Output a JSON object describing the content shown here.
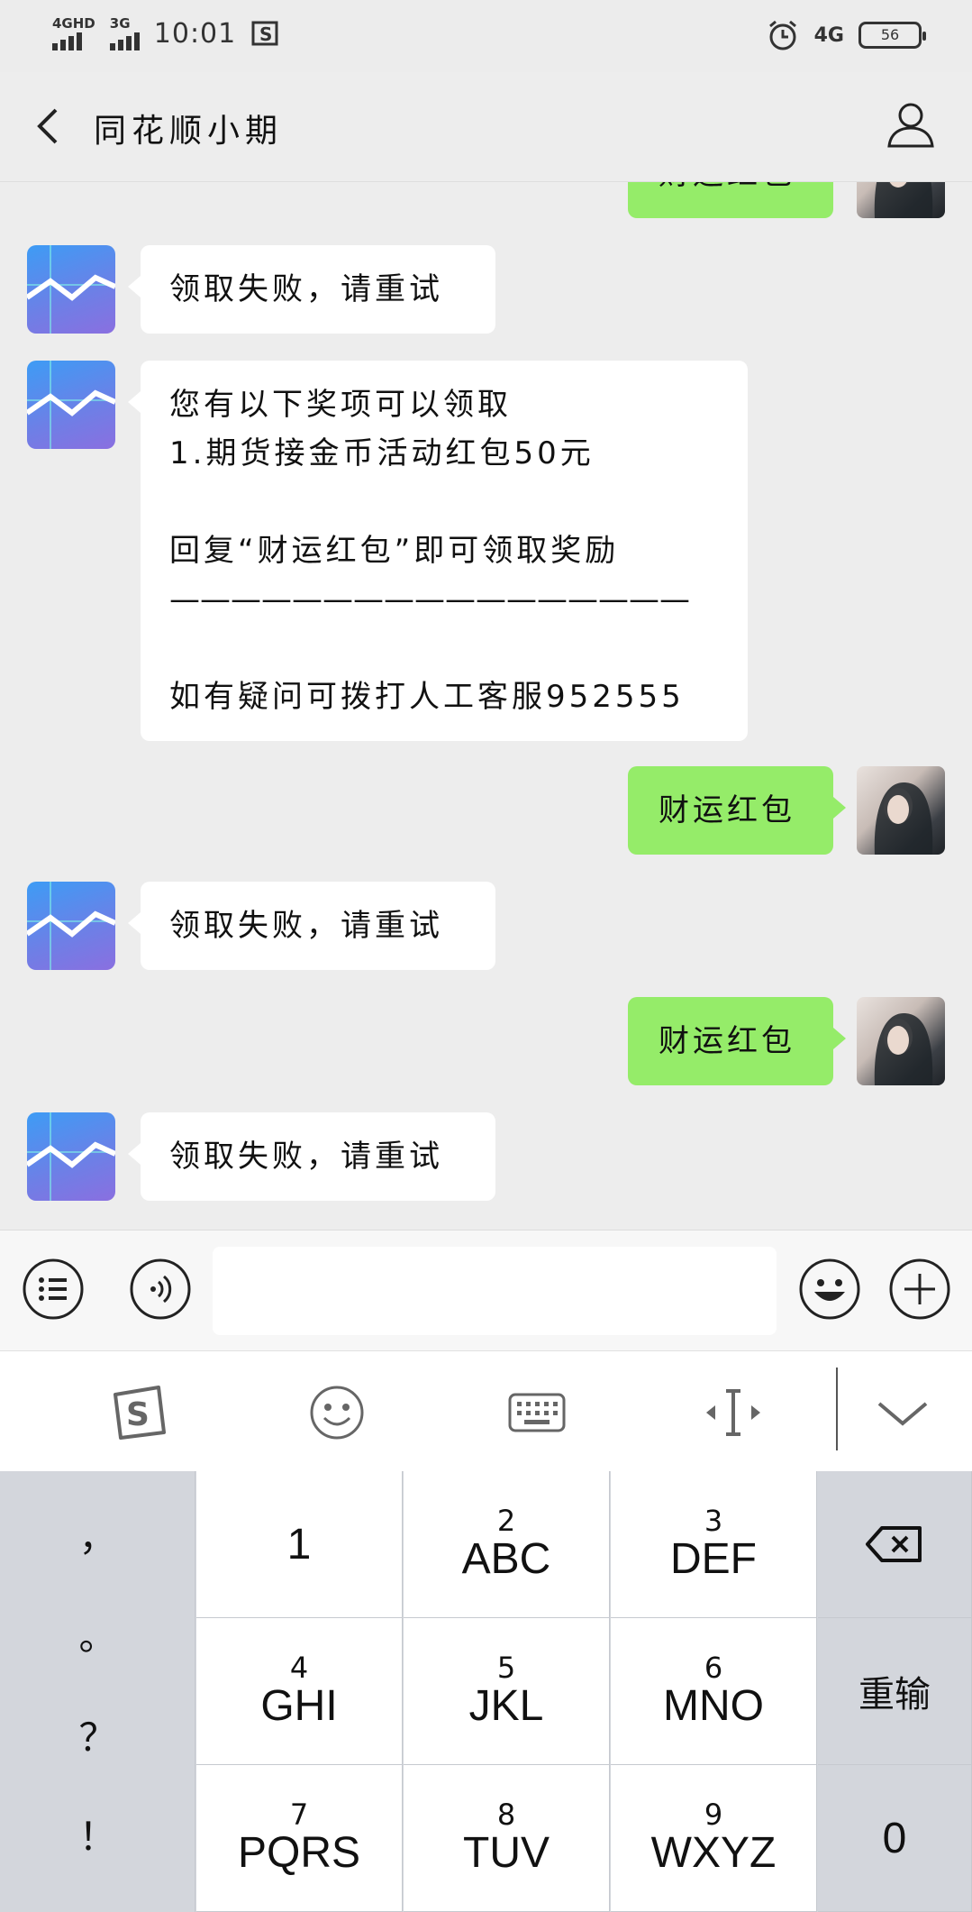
{
  "status_bar": {
    "net1": "4GHD",
    "net2": "3G",
    "time": "10:01",
    "net_right": "4G",
    "battery": "56"
  },
  "header": {
    "title": "同花顺小期",
    "back_icon": "back-arrow-icon",
    "profile_icon": "person-icon"
  },
  "messages": [
    {
      "side": "out",
      "lines": [
        "财运红包"
      ]
    },
    {
      "side": "in",
      "lines": [
        "领取失败，请重试"
      ]
    },
    {
      "side": "in",
      "lines": [
        "您有以下奖项可以领取",
        "1.期货接金币活动红包50元",
        "",
        "回复“财运红包”即可领取奖励",
        "—————————————————",
        "",
        "如有疑问可拨打人工客服952555"
      ]
    },
    {
      "side": "out",
      "lines": [
        "财运红包"
      ]
    },
    {
      "side": "in",
      "lines": [
        "领取失败，请重试"
      ]
    },
    {
      "side": "out",
      "lines": [
        "财运红包"
      ]
    },
    {
      "side": "in",
      "lines": [
        "领取失败，请重试"
      ]
    }
  ],
  "input_bar": {
    "menu_icon": "menu-list-icon",
    "voice_icon": "voice-icon",
    "input_value": "",
    "emoji_icon": "emoji-icon",
    "plus_icon": "plus-icon"
  },
  "keyboard_toolbar": {
    "icons": [
      "sogou-logo-icon",
      "emoji-icon",
      "keyboard-icon",
      "cursor-move-icon",
      "chevron-down-icon"
    ]
  },
  "keyboard": {
    "punctuation": [
      "，",
      "。",
      "？",
      "！"
    ],
    "keys": [
      {
        "num": "",
        "letters": "1"
      },
      {
        "num": "2",
        "letters": "ABC"
      },
      {
        "num": "3",
        "letters": "DEF"
      },
      {
        "num": "4",
        "letters": "GHI"
      },
      {
        "num": "5",
        "letters": "JKL"
      },
      {
        "num": "6",
        "letters": "MNO"
      },
      {
        "num": "7",
        "letters": "PQRS"
      },
      {
        "num": "8",
        "letters": "TUV"
      },
      {
        "num": "9",
        "letters": "WXYZ"
      }
    ],
    "retype": "重输",
    "zero": "0",
    "backspace_icon": "backspace-icon"
  }
}
